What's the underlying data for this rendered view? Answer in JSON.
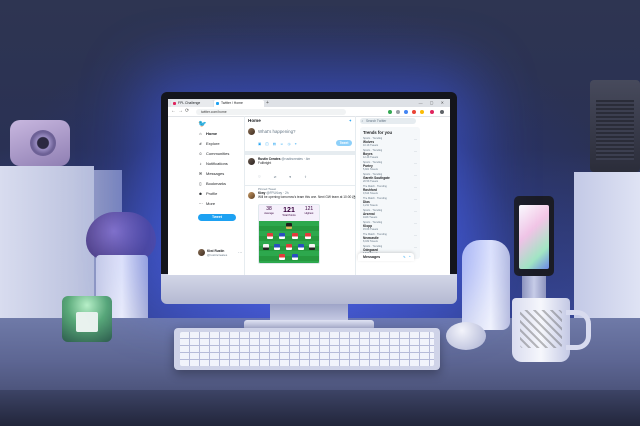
{
  "colors": {
    "twitter_blue": "#1da1f2",
    "backlight": "#5a6eff",
    "fpl_purple": "#37003c"
  },
  "browser": {
    "tabs": [
      {
        "label": "FPL Challenge",
        "icon": "fpl-favicon",
        "color": "#e0245e"
      },
      {
        "label": "Twitter / Home",
        "icon": "twitter-favicon",
        "color": "#1da1f2"
      }
    ],
    "new_tab_symbol": "+",
    "window_controls": "— ▢ ✕",
    "url": "twitter.com/home",
    "nav": {
      "back": "←",
      "forward": "→",
      "reload": "⟳"
    }
  },
  "sidebar": {
    "logo_icon": "twitter-bird-icon",
    "items": [
      {
        "label": "Home",
        "icon": "home-icon",
        "glyph": "⌂"
      },
      {
        "label": "Explore",
        "icon": "hashtag-icon",
        "glyph": "#"
      },
      {
        "label": "Communities",
        "icon": "communities-icon",
        "glyph": "☺"
      },
      {
        "label": "Notifications",
        "icon": "bell-icon",
        "glyph": "♪"
      },
      {
        "label": "Messages",
        "icon": "mail-icon",
        "glyph": "✉"
      },
      {
        "label": "Bookmarks",
        "icon": "bookmark-icon",
        "glyph": "▯"
      },
      {
        "label": "Profile",
        "icon": "person-icon",
        "glyph": "☻"
      },
      {
        "label": "More",
        "icon": "more-icon",
        "glyph": "⋯"
      }
    ],
    "tweet_button": "Tweet",
    "profile": {
      "name": "Kiwi Rustin",
      "handle": "@rustincreates"
    }
  },
  "main": {
    "title": "Home",
    "compose_placeholder": "What's happening?",
    "compose_tools": "▣ ◫ ▤ ☺ ◷ ⌖",
    "compose_button": "Tweet",
    "tweets": [
      {
        "author": "Rustin Creates",
        "handle": "@rustincreates · 4m",
        "body": "Fullbright",
        "actions": "♡ ⇄ ♥ ⇪"
      },
      {
        "pinned": "Pinned Tweet",
        "author": "Kiwy",
        "handle": "@FPLKiwy · 2h",
        "body": "Will be opening tomorrow's team this one. Next GW team at 10:00 ⚽",
        "card": {
          "left_value": "38",
          "left_label": "Average",
          "main_value": "121",
          "main_label": "Total Points",
          "right_value": "121",
          "right_label": "Highest"
        }
      }
    ]
  },
  "right": {
    "search_placeholder": "Search Twitter",
    "trends_title": "Trends for you",
    "trends": [
      {
        "category": "Sports · Trending",
        "name": "Wolves",
        "count": "10.1K Tweets"
      },
      {
        "category": "Sports · Trending",
        "name": "Boyes",
        "count": "12.4K Tweets"
      },
      {
        "category": "Sports · Trending",
        "name": "Partey",
        "count": "5,821 Tweets"
      },
      {
        "category": "Sports · Trending",
        "name": "Gareth Southgate",
        "count": "20.5K Tweets"
      },
      {
        "category": "The Match · Trending",
        "name": "Rashford",
        "count": "9,614 Tweets"
      },
      {
        "category": "The Match · Trending",
        "name": "Dias",
        "count": "4,211 Tweets"
      },
      {
        "category": "Sports · Trending",
        "name": "Arsenal",
        "count": "110K Tweets"
      },
      {
        "category": "Sports · Trending",
        "name": "Klopp",
        "count": "15.6K Tweets"
      },
      {
        "category": "The Match · Trending",
        "name": "Newcastle",
        "count": "8,032 Tweets"
      },
      {
        "category": "Sports · Trending",
        "name": "Odegaard",
        "count": "6,540 Tweets"
      }
    ],
    "messages_label": "Messages",
    "messages_icons": "✎ ⌃"
  },
  "hardware": {
    "apple_logo": ""
  }
}
